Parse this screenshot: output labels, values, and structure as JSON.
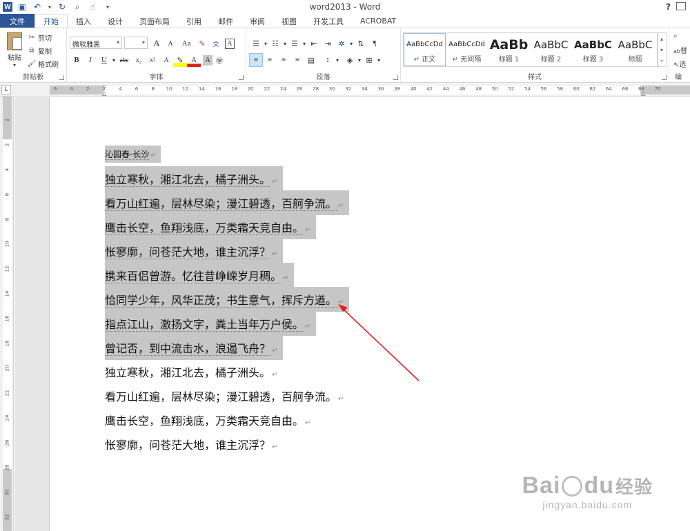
{
  "titlebar": {
    "doc_title": "word2013 - Word",
    "help": "?",
    "logo": "W"
  },
  "tabs": [
    "文件",
    "开始",
    "插入",
    "设计",
    "页面布局",
    "引用",
    "邮件",
    "审阅",
    "视图",
    "开发工具",
    "ACROBAT"
  ],
  "ribbon": {
    "clipboard": {
      "label": "剪贴板",
      "paste": "粘贴",
      "cut": "剪切",
      "copy": "复制",
      "format_painter": "格式刷"
    },
    "font": {
      "label": "字体",
      "font_name": "微软雅黑",
      "font_size": "",
      "grow": "A",
      "shrink": "A",
      "case": "Aa",
      "bold": "B",
      "italic": "I",
      "underline": "U",
      "strikethrough": "abc",
      "subscript": "x₂",
      "superscript": "x²"
    },
    "paragraph": {
      "label": "段落"
    },
    "styles": {
      "label": "样式",
      "items": [
        {
          "sample": "AaBbCcDd",
          "name": "↵ 正文"
        },
        {
          "sample": "AaBbCcDd",
          "name": "↵ 无间隔"
        },
        {
          "sample": "AaBb",
          "name": "标题 1"
        },
        {
          "sample": "AaBbC",
          "name": "标题 2"
        },
        {
          "sample": "AaBbC",
          "name": "标题 3"
        },
        {
          "sample": "AaBbC",
          "name": "标题"
        }
      ]
    },
    "editing": {
      "label": "编",
      "find": "",
      "replace": "替",
      "select": "选"
    }
  },
  "ruler": {
    "corner": "L",
    "h_ticks": [
      "6",
      "4",
      "2",
      "2",
      "4",
      "6",
      "8",
      "10",
      "12",
      "14",
      "16",
      "18",
      "20",
      "22",
      "24",
      "26",
      "28",
      "30",
      "32",
      "34",
      "36",
      "38",
      "40",
      "42",
      "44",
      "46",
      "48",
      "50",
      "52",
      "54",
      "56",
      "58",
      "60",
      "62",
      "64",
      "66",
      "68",
      "70"
    ],
    "v_ticks": [
      "2",
      "2",
      "4",
      "6",
      "8",
      "10",
      "12",
      "14",
      "16",
      "18",
      "20",
      "22",
      "24",
      "26",
      "28",
      "30",
      "32"
    ]
  },
  "document": {
    "title": "沁园春-长沙",
    "lines": [
      "独立寒秋，湘江北去，橘子洲头。",
      "看万山红遍，层林尽染；漫江碧透，百舸争流。",
      "鹰击长空，鱼翔浅底，万类霜天竞自由。",
      "怅寥廓，问苍茫大地，谁主沉浮？",
      "携来百侣曾游。忆往昔峥嵘岁月稠。",
      "恰同学少年，风华正茂；书生意气，挥斥方遒。",
      "指点江山，激扬文字，粪土当年万户侯。",
      "曾记否，到中流击水，浪遏飞舟？",
      "独立寒秋，湘江北去，橘子洲头。",
      "看万山红遍，层林尽染；漫江碧透，百舸争流。",
      "鹰击长空，鱼翔浅底，万类霜天竞自由。",
      "怅寥廓，问苍茫大地，谁主沉浮？"
    ],
    "paragraph_mark": "↵"
  },
  "watermark": {
    "main": "Bai",
    "main2": "du",
    "brand": "经验",
    "sub": "jingyan.baidu.com"
  },
  "colors": {
    "word_blue": "#2b579a",
    "selection": "#c6c6c6",
    "arrow": "#e02020"
  }
}
